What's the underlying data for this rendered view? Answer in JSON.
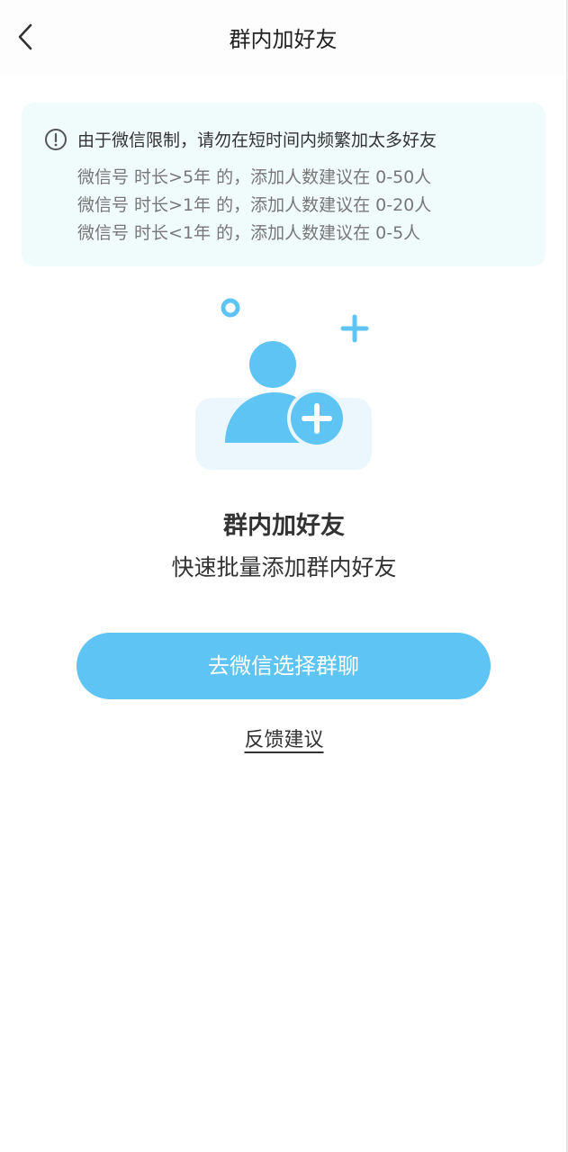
{
  "nav": {
    "title": "群内加好友",
    "back_icon": "chevron-left-icon"
  },
  "notice": {
    "icon": "exclamation-circle-icon",
    "headline": "由于微信限制，请勿在短时间内频繁加太多好友",
    "lines": [
      "微信号 时长>5年 的，添加人数建议在 0-50人",
      "微信号 时长>1年 的，添加人数建议在 0-20人",
      "微信号 时长<1年 的，添加人数建议在 0-5人"
    ]
  },
  "hero": {
    "icon": "add-user-icon",
    "title": "群内加好友",
    "subtitle": "快速批量添加群内好友"
  },
  "actions": {
    "primary_label": "去微信选择群聊",
    "feedback_label": "反馈建议"
  },
  "colors": {
    "accent": "#5ec4f3",
    "notice_bg": "#f0fbfb",
    "icon_bg": "#ecf7fd"
  }
}
